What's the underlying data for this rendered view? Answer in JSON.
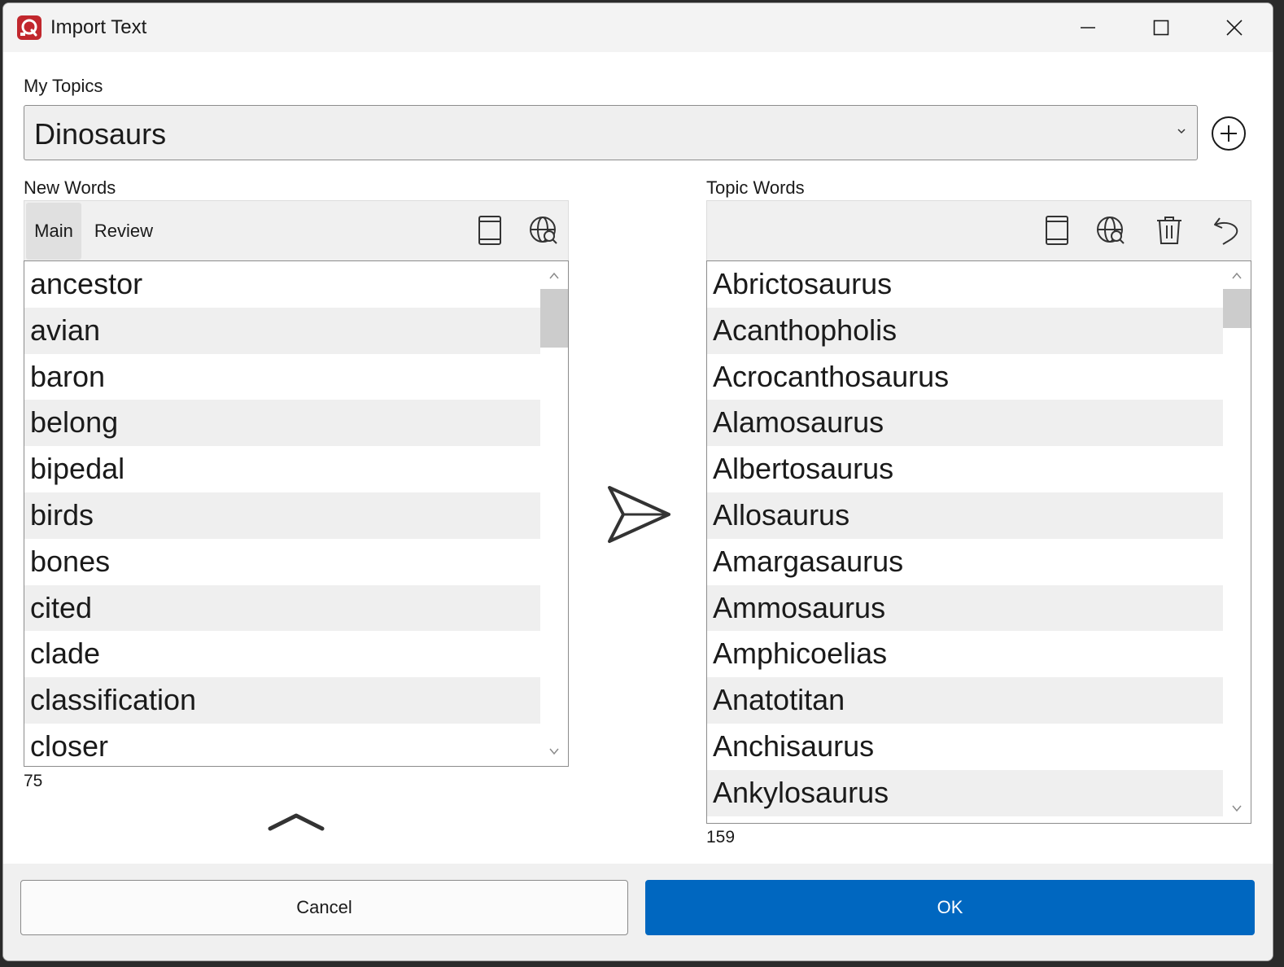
{
  "window": {
    "title": "Import Text",
    "controls": {
      "minimize": "minimize-icon",
      "maximize": "maximize-icon",
      "close": "close-icon"
    }
  },
  "my_topics": {
    "label": "My Topics",
    "selected": "Dinosaurs",
    "add_icon": "plus-circle-icon"
  },
  "new_words": {
    "label": "New Words",
    "tabs": [
      {
        "label": "Main",
        "active": true
      },
      {
        "label": "Review",
        "active": false
      }
    ],
    "tools": [
      "book-icon",
      "globe-search-icon"
    ],
    "items": [
      "ancestor",
      "avian",
      "baron",
      "belong",
      "bipedal",
      "birds",
      "bones",
      "cited",
      "clade",
      "classification",
      "closer"
    ],
    "count": "75"
  },
  "topic_words": {
    "label": "Topic Words",
    "tools": [
      "book-icon",
      "globe-search-icon",
      "trash-icon",
      "undo-icon"
    ],
    "items": [
      "Abrictosaurus",
      "Acanthopholis",
      "Acrocanthosaurus",
      "Alamosaurus",
      "Albertosaurus",
      "Allosaurus",
      "Amargasaurus",
      "Ammosaurus",
      "Amphicoelias",
      "Anatotitan",
      "Anchisaurus",
      "Ankylosaurus"
    ],
    "count": "159"
  },
  "actions": {
    "cancel": "Cancel",
    "ok": "OK"
  },
  "colors": {
    "accent": "#0067c0",
    "app_icon": "#c1272d",
    "row_alt": "#efefef"
  }
}
